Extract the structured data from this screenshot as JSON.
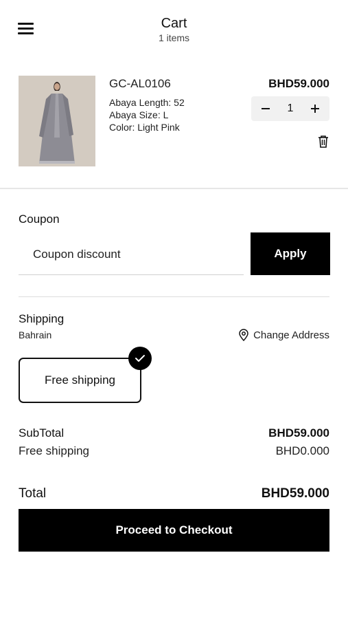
{
  "header": {
    "title": "Cart",
    "subtitle": "1 items",
    "menu_icon": "hamburger-menu-icon"
  },
  "cart": {
    "items": [
      {
        "name": "GC-AL0106",
        "attributes": [
          "Abaya Length: 52",
          "Abaya Size: L",
          "Color: Light Pink"
        ],
        "price": "BHD59.000",
        "quantity": "1",
        "decrement_icon": "minus-icon",
        "increment_icon": "plus-icon",
        "remove_icon": "trash-icon"
      }
    ]
  },
  "coupon": {
    "label": "Coupon",
    "placeholder": "Coupon discount",
    "apply_label": "Apply"
  },
  "shipping": {
    "label": "Shipping",
    "region": "Bahrain",
    "change_address_label": "Change Address",
    "change_address_icon": "location-pin-icon",
    "options": [
      {
        "label": "Free shipping",
        "selected": true
      }
    ]
  },
  "summary": {
    "subtotal_label": "SubTotal",
    "subtotal_value": "BHD59.000",
    "shipping_label": "Free shipping",
    "shipping_value": "BHD0.000",
    "total_label": "Total",
    "total_value": "BHD59.000"
  },
  "checkout": {
    "label": "Proceed to Checkout"
  },
  "colors": {
    "primary": "#000000",
    "background": "#ffffff",
    "stepper_bg": "#f1f1f1"
  }
}
